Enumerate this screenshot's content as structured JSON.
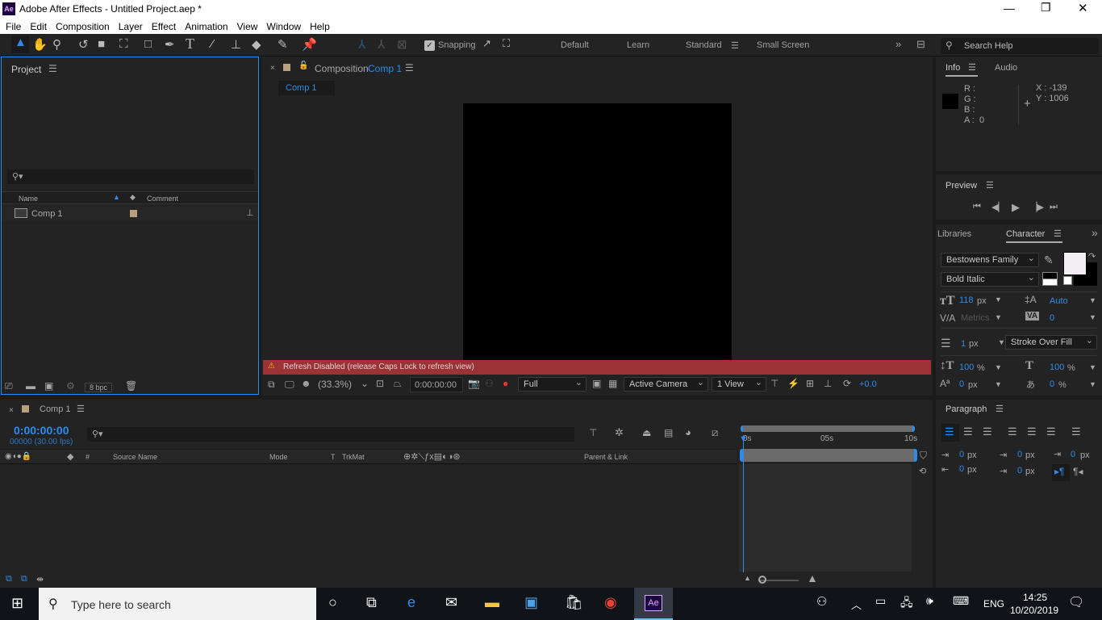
{
  "window": {
    "title": "Adobe After Effects - Untitled Project.aep *",
    "app_icon": "Ae",
    "controls": [
      "minimize",
      "maximize",
      "close"
    ]
  },
  "menu": [
    "File",
    "Edit",
    "Composition",
    "Layer",
    "Effect",
    "Animation",
    "View",
    "Window",
    "Help"
  ],
  "toolbar": {
    "snapping": "Snapping",
    "workspaces": [
      "Default",
      "Learn",
      "Standard",
      "Small Screen"
    ],
    "active_workspace": "Standard",
    "search_placeholder": "Search Help"
  },
  "project": {
    "title": "Project",
    "col_name": "Name",
    "col_comment": "Comment",
    "items": [
      {
        "name": "Comp 1"
      }
    ],
    "bpc": "8 bpc"
  },
  "composition": {
    "panel_label": "Composition",
    "comp_name": "Comp 1",
    "sub_tab": "Comp 1",
    "warning": "Refresh Disabled (release Caps Lock to refresh view)",
    "zoom": "(33.3%)",
    "timecode": "0:00:00:00",
    "resolution": "Full",
    "camera": "Active Camera",
    "views": "1 View",
    "exposure": "+0.0"
  },
  "info": {
    "tab": "Info",
    "tab2": "Audio",
    "r": "R :",
    "g": "G :",
    "b": "B :",
    "a": "A :",
    "a_val": "0",
    "x": "X : -139",
    "y": "Y : 1006"
  },
  "preview": {
    "title": "Preview"
  },
  "character": {
    "tab1": "Libraries",
    "tab2": "Character",
    "font": "Bestowens Family",
    "style": "Bold Italic",
    "size": "118",
    "size_unit": "px",
    "leading": "Auto",
    "kerning": "Metrics",
    "tracking": "0",
    "stroke": "1",
    "stroke_unit": "px",
    "stroke_mode": "Stroke Over Fill",
    "vscale": "100",
    "hscale": "100",
    "pct": "%",
    "baseline": "0",
    "baseline_unit": "px",
    "tsume": "0",
    "fill_color": "#f3eef3",
    "stroke_color": "#000000"
  },
  "paragraph": {
    "title": "Paragraph",
    "indent_left": "0",
    "indent_first": "0",
    "indent_right": "0",
    "space_before": "0",
    "space_after": "0",
    "unit": "px"
  },
  "timeline": {
    "comp_name": "Comp 1",
    "timecode": "0:00:00:00",
    "frames": "00000 (30.00 fps)",
    "cols": {
      "num": "#",
      "source": "Source Name",
      "mode": "Mode",
      "t": "T",
      "trkmat": "TrkMat",
      "parent": "Parent & Link"
    },
    "ruler": [
      "0s",
      "05s",
      "10s"
    ]
  },
  "taskbar": {
    "search_placeholder": "Type here to search",
    "lang": "ENG",
    "time": "14:25",
    "date": "10/20/2019"
  }
}
